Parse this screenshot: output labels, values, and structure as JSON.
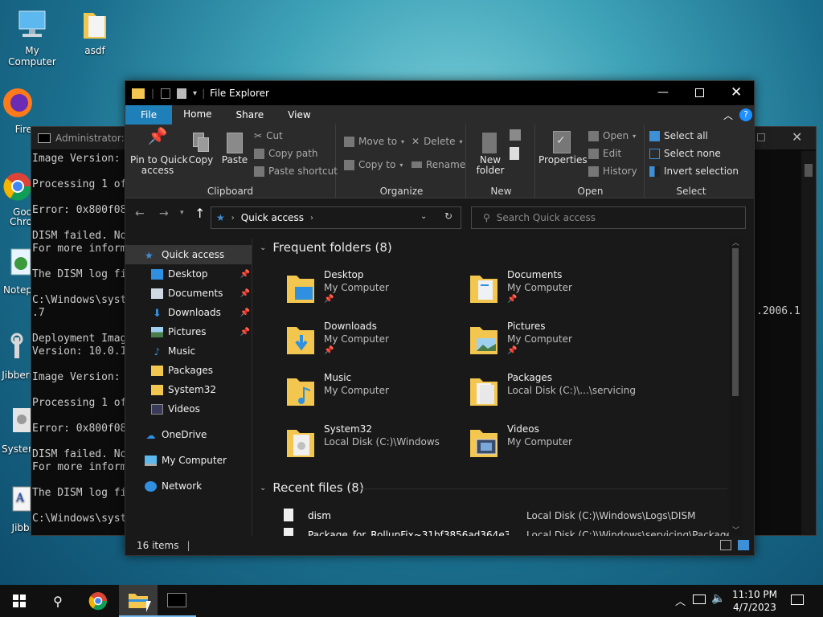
{
  "desktop": {
    "icons": [
      {
        "label": "My Computer",
        "icon": "monitor-icon"
      },
      {
        "label": "asdf",
        "icon": "folder-icon"
      },
      {
        "label": "Fire",
        "icon": "firefox-icon"
      },
      {
        "label": "Goo\nChro",
        "icon": "chrome-icon"
      },
      {
        "label": "Notep",
        "icon": "notepad-icon"
      },
      {
        "label": "Jibberi",
        "icon": "wrench-icon"
      },
      {
        "label": "Syster",
        "icon": "gear-icon"
      },
      {
        "label": "Jibbi",
        "icon": "document-icon"
      }
    ]
  },
  "cmd": {
    "title": "Administrator: C",
    "lines": "Image Version: 1\n\nProcessing 1 of\n\nError: 0x800f08\n\nDISM failed. No\nFor more inform\n\nThe DISM log fi\n\nC:\\Windows\\syst\n.7\n\nDeployment Imag\nVersion: 10.0.1\n\nImage Version: \n\nProcessing 1 of\n\nError: 0x800f08\n\nDISM failed. No\nFor more inform\n\nThe DISM log fi\n\nC:\\Windows\\syst",
    "right_text": ".2006.1"
  },
  "explorer": {
    "title": "File Explorer",
    "tabs": [
      "File",
      "Home",
      "Share",
      "View"
    ],
    "ribbon": {
      "clipboard": {
        "label": "Clipboard",
        "pin": "Pin to Quick\naccess",
        "copy": "Copy",
        "paste": "Paste",
        "cut": "Cut",
        "copy_path": "Copy path",
        "paste_shortcut": "Paste shortcut"
      },
      "organize": {
        "label": "Organize",
        "move_to": "Move to",
        "copy_to": "Copy to",
        "delete": "Delete",
        "rename": "Rename"
      },
      "new": {
        "label": "New",
        "new_folder": "New\nfolder"
      },
      "open": {
        "label": "Open",
        "properties": "Properties",
        "open": "Open",
        "edit": "Edit",
        "history": "History"
      },
      "select": {
        "label": "Select",
        "select_all": "Select all",
        "select_none": "Select none",
        "invert": "Invert selection"
      }
    },
    "address": {
      "location": "Quick access",
      "search_placeholder": "Search Quick access"
    },
    "nav": [
      {
        "label": "Quick access",
        "pinned": false,
        "icon": "star-icon"
      },
      {
        "label": "Desktop",
        "pinned": true,
        "icon": "desktop-icon"
      },
      {
        "label": "Documents",
        "pinned": true,
        "icon": "documents-icon"
      },
      {
        "label": "Downloads",
        "pinned": true,
        "icon": "downloads-icon"
      },
      {
        "label": "Pictures",
        "pinned": true,
        "icon": "pictures-icon"
      },
      {
        "label": "Music",
        "pinned": false,
        "icon": "music-icon"
      },
      {
        "label": "Packages",
        "pinned": false,
        "icon": "folder-icon"
      },
      {
        "label": "System32",
        "pinned": false,
        "icon": "folder-icon"
      },
      {
        "label": "Videos",
        "pinned": false,
        "icon": "videos-icon"
      },
      {
        "label": "OneDrive",
        "pinned": false,
        "icon": "cloud-icon"
      },
      {
        "label": "My Computer",
        "pinned": false,
        "icon": "computer-icon"
      },
      {
        "label": "Network",
        "pinned": false,
        "icon": "network-icon"
      }
    ],
    "frequent_header": "Frequent folders (8)",
    "frequent": [
      {
        "name": "Desktop",
        "location": "My Computer",
        "pinned": true
      },
      {
        "name": "Documents",
        "location": "My Computer",
        "pinned": true
      },
      {
        "name": "Downloads",
        "location": "My Computer",
        "pinned": true
      },
      {
        "name": "Pictures",
        "location": "My Computer",
        "pinned": true
      },
      {
        "name": "Music",
        "location": "My Computer",
        "pinned": false
      },
      {
        "name": "Packages",
        "location": "Local Disk (C:)\\...\\servicing",
        "pinned": false
      },
      {
        "name": "System32",
        "location": "Local Disk (C:)\\Windows",
        "pinned": false
      },
      {
        "name": "Videos",
        "location": "My Computer",
        "pinned": false
      }
    ],
    "recent_header": "Recent files (8)",
    "recent": [
      {
        "name": "dism",
        "path": "Local Disk (C:)\\Windows\\Logs\\DISM"
      },
      {
        "name": "Package_for_RollupFix~31bf3856ad364e35~am...",
        "path": "Local Disk (C:)\\Windows\\servicing\\Packages"
      }
    ],
    "status": "16 items"
  },
  "taskbar": {
    "time": "11:10 PM",
    "date": "4/7/2023"
  },
  "colors": {
    "accent": "#1e90ff",
    "folder": "#f3c64f",
    "file_tab": "#1f7fb8"
  }
}
